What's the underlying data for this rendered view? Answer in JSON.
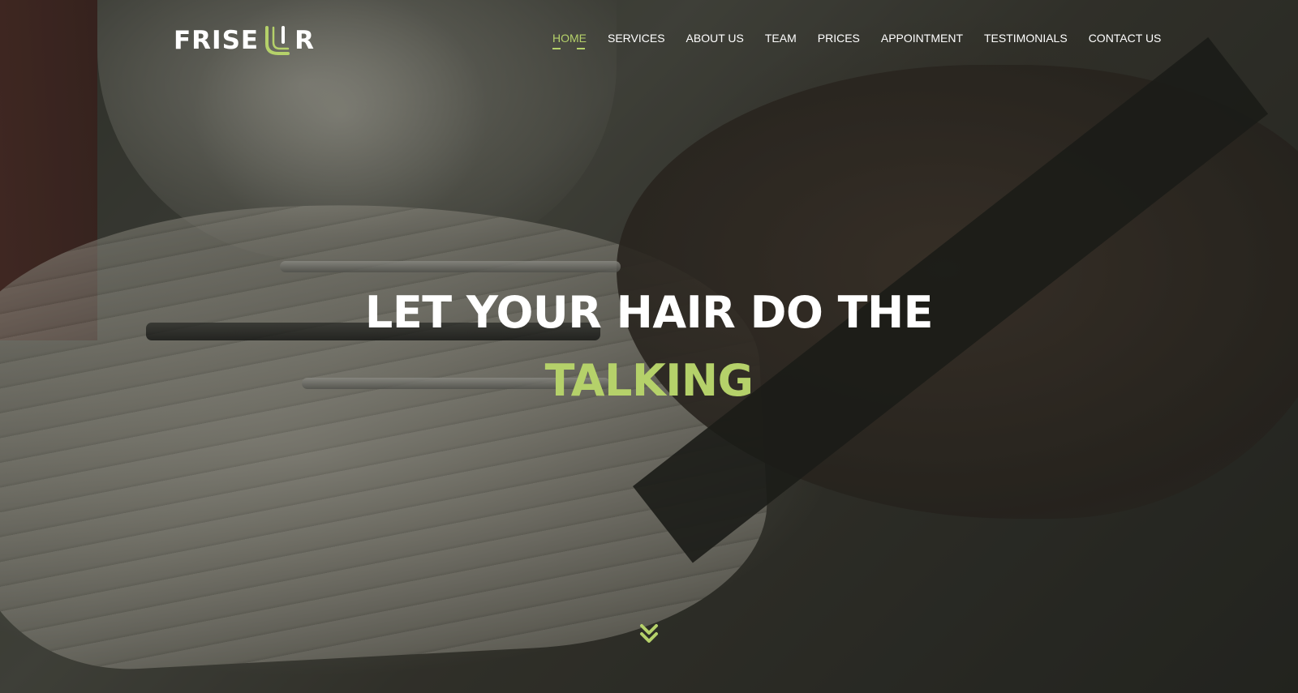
{
  "brand": {
    "logo_left": "FRISE",
    "logo_right": "R",
    "accent_color": "#b5d16a"
  },
  "nav": {
    "items": [
      {
        "label": "HOME",
        "active": true
      },
      {
        "label": "SERVICES",
        "active": false
      },
      {
        "label": "ABOUT US",
        "active": false
      },
      {
        "label": "TEAM",
        "active": false
      },
      {
        "label": "PRICES",
        "active": false
      },
      {
        "label": "APPOINTMENT",
        "active": false
      },
      {
        "label": "TESTIMONIALS",
        "active": false
      },
      {
        "label": "CONTACT US",
        "active": false
      }
    ]
  },
  "hero": {
    "headline_line1": "LET YOUR HAIR DO THE",
    "headline_line2": "TALKING",
    "scroll_icon": "double-chevron-down-icon"
  }
}
